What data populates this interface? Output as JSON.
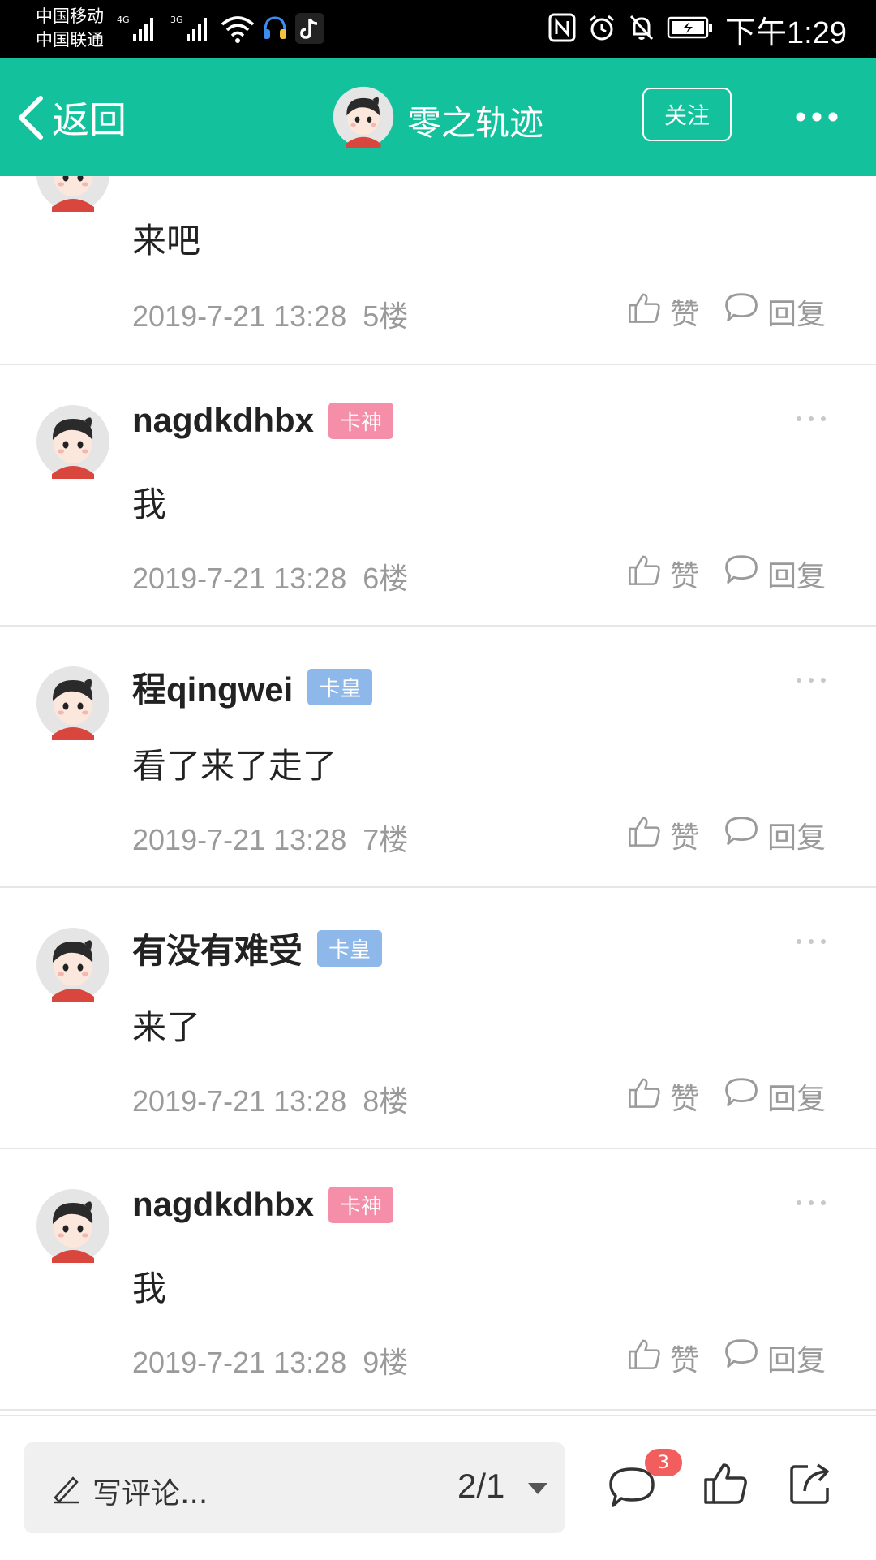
{
  "status_bar": {
    "carrier1": "中国移动",
    "carrier2": "中国联通",
    "net1": "4G",
    "net2": "3G",
    "time": "下午1:29"
  },
  "header": {
    "back_label": "返回",
    "title": "零之轨迹",
    "follow_label": "关注"
  },
  "posts": [
    {
      "name": "",
      "badge": "",
      "content": "来吧",
      "time": "2019-7-21 13:28",
      "floor": "5楼",
      "like_label": "赞",
      "reply_label": "回复"
    },
    {
      "name": "nagdkdhbx",
      "badge": "卡神",
      "badge_color": "#f58ea8",
      "content": "我",
      "time": "2019-7-21 13:28",
      "floor": "6楼",
      "like_label": "赞",
      "reply_label": "回复"
    },
    {
      "name": "程qingwei",
      "badge": "卡皇",
      "badge_color": "#8eb7ea",
      "content": "看了来了走了",
      "time": "2019-7-21 13:28",
      "floor": "7楼",
      "like_label": "赞",
      "reply_label": "回复"
    },
    {
      "name": "有没有难受",
      "badge": "卡皇",
      "badge_color": "#8eb7ea",
      "content": "来了",
      "time": "2019-7-21 13:28",
      "floor": "8楼",
      "like_label": "赞",
      "reply_label": "回复"
    },
    {
      "name": "nagdkdhbx",
      "badge": "卡神",
      "badge_color": "#f58ea8",
      "content": "我",
      "time": "2019-7-21 13:28",
      "floor": "9楼",
      "like_label": "赞",
      "reply_label": "回复"
    }
  ],
  "bottom_bar": {
    "placeholder": "写评论...",
    "page_indicator": "2/1",
    "comment_count": "3"
  },
  "colors": {
    "brand": "#13c29c",
    "badge_pink": "#f58ea8",
    "badge_blue": "#8eb7ea",
    "count_badge": "#f25d5d"
  }
}
